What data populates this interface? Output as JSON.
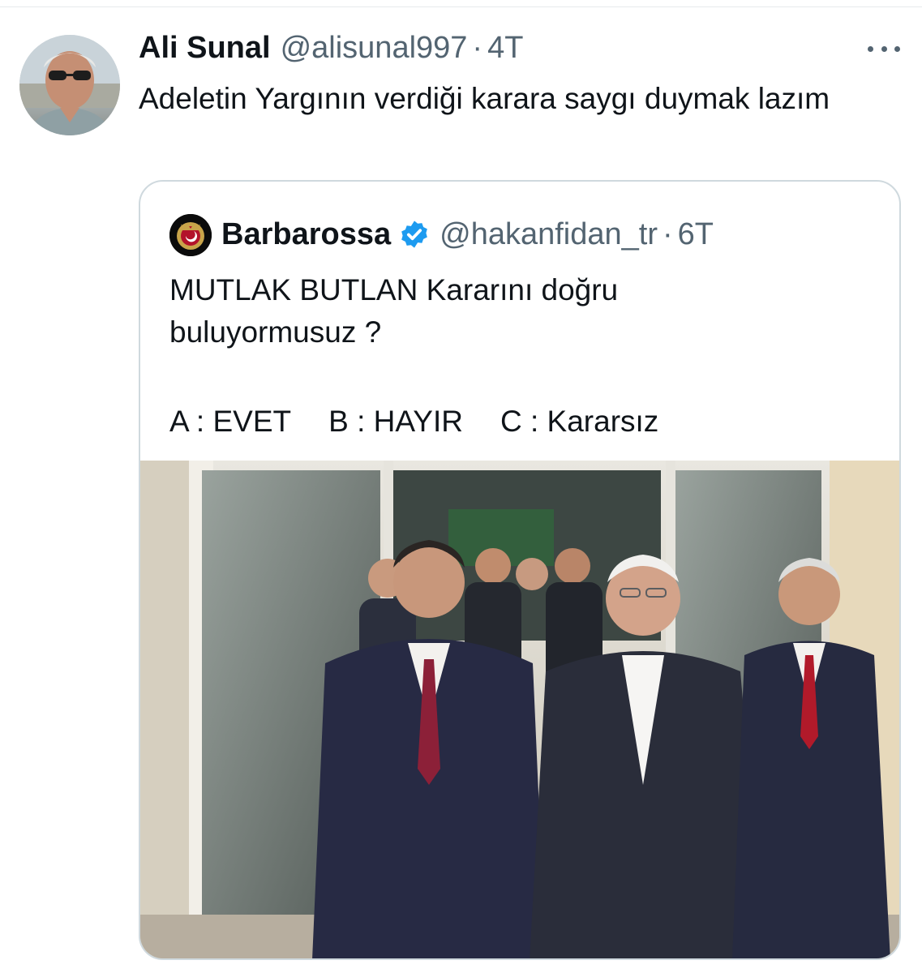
{
  "tweet": {
    "author_name": "Ali Sunal",
    "author_handle": "@alisunal997",
    "separator": "·",
    "timestamp": "4T",
    "text": "Adeletin Yargının verdiği karara saygı duymak lazım",
    "avatar_icon": "user-avatar-photo",
    "more_icon": "more-options-icon"
  },
  "quote": {
    "author_name": "Barbarossa",
    "author_handle": "@hakanfidan_tr",
    "separator": "·",
    "timestamp": "6T",
    "verified_icon": "verified-badge-icon",
    "verified_color": "#1d9bf0",
    "text_line1": "MUTLAK BUTLAN Kararını doğru",
    "text_line2": "buluyormusuz ?",
    "options": [
      "A : EVET",
      "B : HAYIR",
      "C : Kararsız"
    ],
    "media_icon": "photo-of-politicians-walking"
  },
  "colors": {
    "text_primary": "#0f1419",
    "text_secondary": "#536471",
    "border": "#cfd9de"
  }
}
